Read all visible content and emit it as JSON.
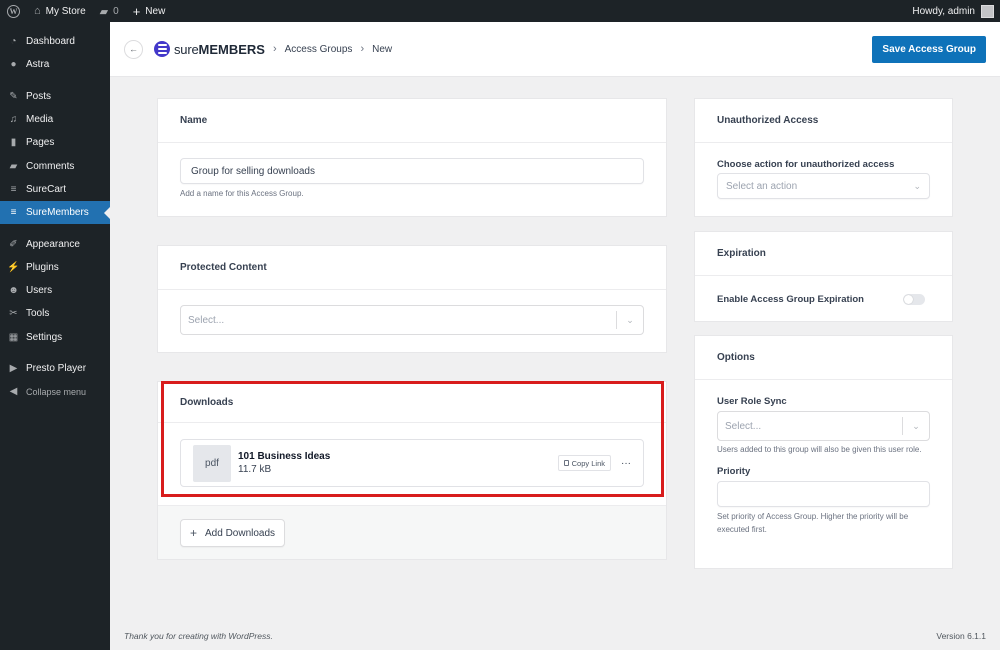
{
  "admin_bar": {
    "site_name": "My Store",
    "comments_count": "0",
    "new_label": "New",
    "greeting": "Howdy, admin"
  },
  "sidebar": {
    "items": [
      {
        "label": "Dashboard",
        "icon": "dashboard-icon"
      },
      {
        "label": "Astra",
        "icon": "astra-icon"
      },
      {
        "label": "Posts",
        "icon": "pin-icon"
      },
      {
        "label": "Media",
        "icon": "media-icon"
      },
      {
        "label": "Pages",
        "icon": "pages-icon"
      },
      {
        "label": "Comments",
        "icon": "comment-icon"
      },
      {
        "label": "SureCart",
        "icon": "surecart-icon"
      },
      {
        "label": "SureMembers",
        "icon": "suremembers-icon",
        "active": true
      },
      {
        "label": "Appearance",
        "icon": "brush-icon"
      },
      {
        "label": "Plugins",
        "icon": "plugin-icon"
      },
      {
        "label": "Users",
        "icon": "users-icon"
      },
      {
        "label": "Tools",
        "icon": "wrench-icon"
      },
      {
        "label": "Settings",
        "icon": "settings-icon"
      },
      {
        "label": "Presto Player",
        "icon": "presto-icon"
      },
      {
        "label": "Collapse menu",
        "icon": "collapse-icon"
      }
    ]
  },
  "header": {
    "brand_light": "sure",
    "brand_bold": "MEMBERS",
    "breadcrumb": [
      "Access Groups",
      "New"
    ],
    "save_label": "Save Access Group",
    "accent": "#0e72b9"
  },
  "name_card": {
    "title": "Name",
    "value": "Group for selling downloads",
    "help": "Add a name for this Access Group."
  },
  "protected_card": {
    "title": "Protected Content",
    "placeholder": "Select..."
  },
  "downloads_card": {
    "title": "Downloads",
    "files": [
      {
        "type": "pdf",
        "name": "101 Business Ideas",
        "size": "11.7 kB"
      }
    ],
    "copy_link_label": "Copy Link",
    "more_label": "···",
    "add_label": "Add Downloads"
  },
  "unauthorized_card": {
    "title": "Unauthorized Access",
    "field_label": "Choose action for unauthorized access",
    "placeholder": "Select an action"
  },
  "expiration_card": {
    "title": "Expiration",
    "toggle_label": "Enable Access Group Expiration",
    "enabled": false
  },
  "options_card": {
    "title": "Options",
    "role_label": "User Role Sync",
    "role_placeholder": "Select...",
    "role_help": "Users added to this group will also be given this user role.",
    "priority_label": "Priority",
    "priority_value": "",
    "priority_help": "Set priority of Access Group. Higher the priority will be executed first."
  },
  "footer": {
    "thanks": "Thank you for creating with WordPress.",
    "version": "Version 6.1.1"
  }
}
